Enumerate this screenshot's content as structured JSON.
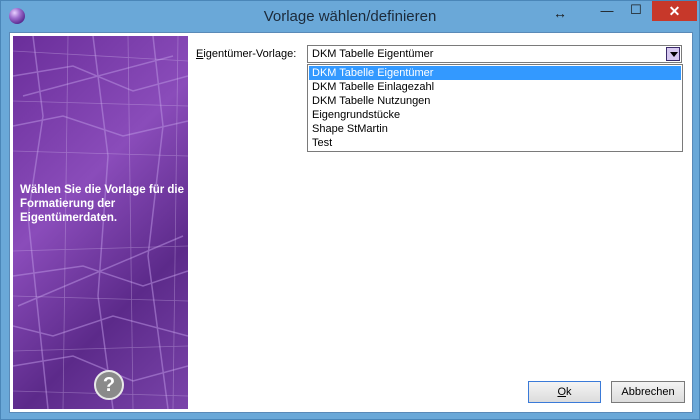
{
  "window": {
    "title": "Vorlage wählen/definieren",
    "icon": "app-orb-icon",
    "controls": {
      "resize": "↔",
      "minimize": "—",
      "maximize": "☐",
      "close": "✕"
    }
  },
  "sidebar": {
    "description": "Wählen Sie die Vorlage für die Formatierung der Eigentümerdaten.",
    "help_glyph": "?",
    "background_color": "#6a2e9a"
  },
  "form": {
    "label_prefix": "E",
    "label_rest": "igentümer-Vorlage:",
    "combo_value": "DKM Tabelle Eigentümer",
    "options": [
      "DKM Tabelle Eigentümer",
      "DKM Tabelle Einlagezahl",
      "DKM Tabelle Nutzungen",
      "Eigengrundstücke",
      "Shape StMartin",
      "Test"
    ],
    "selected_index": 0
  },
  "buttons": {
    "ok_prefix": "O",
    "ok_rest": "k",
    "cancel": "Abbrechen"
  },
  "colors": {
    "selection": "#3399ff",
    "close_button": "#c7382a",
    "title_bar": "#6aa8d8"
  }
}
